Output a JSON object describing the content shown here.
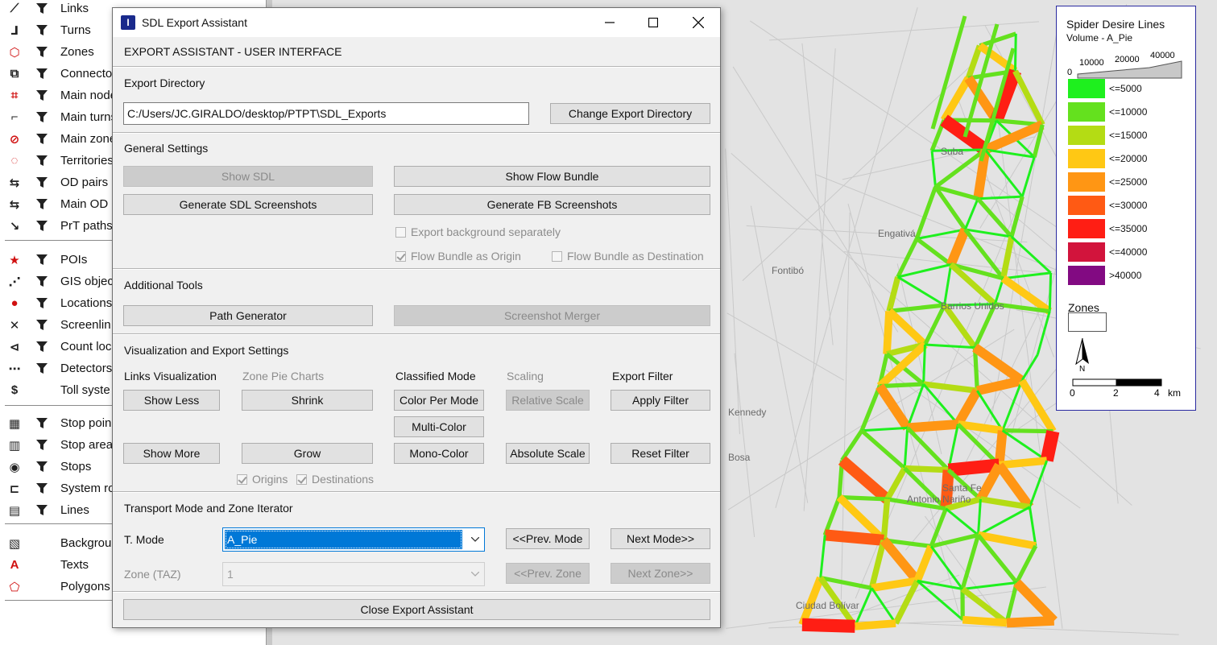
{
  "left_panel": {
    "items": [
      {
        "label": "Links",
        "icon": "links-icon",
        "filter": true
      },
      {
        "label": "Turns",
        "icon": "turns-icon",
        "filter": true
      },
      {
        "label": "Zones",
        "icon": "zones-icon",
        "filter": true
      },
      {
        "label": "Connecto",
        "icon": "connectors-icon",
        "filter": true
      },
      {
        "label": "Main node",
        "icon": "main-nodes-icon",
        "filter": true
      },
      {
        "label": "Main turns",
        "icon": "main-turns-icon",
        "filter": true
      },
      {
        "label": "Main zone",
        "icon": "main-zones-icon",
        "filter": true
      },
      {
        "label": "Territories",
        "icon": "territories-icon",
        "filter": true
      },
      {
        "label": "OD pairs",
        "icon": "od-pairs-icon",
        "filter": true
      },
      {
        "label": "Main OD p",
        "icon": "main-od-pairs-icon",
        "filter": true
      },
      {
        "label": "PrT paths",
        "icon": "prt-paths-icon",
        "filter": true
      },
      {
        "label": "POIs",
        "icon": "pois-icon",
        "filter": true
      },
      {
        "label": "GIS objec",
        "icon": "gis-objects-icon",
        "filter": true
      },
      {
        "label": "Locations",
        "icon": "locations-icon",
        "filter": true
      },
      {
        "label": "Screenlin",
        "icon": "screenlines-icon",
        "filter": true
      },
      {
        "label": "Count loc",
        "icon": "count-locations-icon",
        "filter": true
      },
      {
        "label": "Detectors",
        "icon": "detectors-icon",
        "filter": true
      },
      {
        "label": "Toll syste",
        "icon": "toll-systems-icon",
        "filter": false
      },
      {
        "label": "Stop poin",
        "icon": "stop-points-icon",
        "filter": true
      },
      {
        "label": "Stop area",
        "icon": "stop-areas-icon",
        "filter": true
      },
      {
        "label": "Stops",
        "icon": "stops-icon",
        "filter": true
      },
      {
        "label": "System ro",
        "icon": "system-routes-icon",
        "filter": true
      },
      {
        "label": "Lines",
        "icon": "lines-icon",
        "filter": true
      },
      {
        "label": "Backgrou",
        "icon": "backgrounds-icon",
        "filter": false
      },
      {
        "label": "Texts",
        "icon": "texts-icon",
        "filter": false
      },
      {
        "label": "Polygons",
        "icon": "polygons-icon",
        "filter": false
      }
    ]
  },
  "dialog": {
    "title": "SDL Export Assistant",
    "header": "EXPORT ASSISTANT - USER INTERFACE",
    "export_directory": {
      "heading": "Export Directory",
      "path": "C:/Users/JC.GIRALDO/desktop/PTPT\\SDL_Exports",
      "change_button": "Change Export Directory"
    },
    "general": {
      "heading": "General Settings",
      "show_sdl": "Show SDL",
      "show_flow_bundle": "Show Flow Bundle",
      "gen_sdl_screens": "Generate SDL Screenshots",
      "gen_fb_screens": "Generate FB Screenshots",
      "export_bg": "Export background separately",
      "fb_origin": "Flow Bundle as Origin",
      "fb_destination": "Flow Bundle as Destination"
    },
    "tools": {
      "heading": "Additional Tools",
      "path_generator": "Path Generator",
      "screenshot_merger": "Screenshot Merger"
    },
    "viz": {
      "heading": "Visualization and Export Settings",
      "links_vis": "Links Visualization",
      "zone_pie": "Zone Pie Charts",
      "classified": "Classified Mode",
      "scaling": "Scaling",
      "export_filter": "Export Filter",
      "show_less": "Show Less",
      "shrink": "Shrink",
      "color_per_mode": "Color Per Mode",
      "relative_scale": "Relative Scale",
      "apply_filter": "Apply Filter",
      "multi_color": "Multi-Color",
      "show_more": "Show More",
      "grow": "Grow",
      "mono_color": "Mono-Color",
      "absolute_scale": "Absolute Scale",
      "reset_filter": "Reset Filter",
      "origins": "Origins",
      "destinations": "Destinations"
    },
    "iterator": {
      "heading": "Transport Mode and Zone Iterator",
      "t_mode_label": "T. Mode",
      "t_mode_value": "A_Pie",
      "prev_mode": "<<Prev. Mode",
      "next_mode": "Next Mode>>",
      "zone_label": "Zone (TAZ)",
      "zone_value": "1",
      "prev_zone": "<<Prev. Zone",
      "next_zone": "Next Zone>>"
    },
    "close_button": "Close Export Assistant"
  },
  "legend": {
    "title": "Spider Desire Lines",
    "subtitle": "Volume - A_Pie",
    "scale_labels": [
      "0",
      "10000",
      "20000",
      "40000"
    ],
    "classes": [
      {
        "label": "<=5000",
        "color": "#1ef01e"
      },
      {
        "label": "<=10000",
        "color": "#64e11e"
      },
      {
        "label": "<=15000",
        "color": "#b4dc14"
      },
      {
        "label": "<=20000",
        "color": "#ffc814"
      },
      {
        "label": "<=25000",
        "color": "#ff9614"
      },
      {
        "label": "<=30000",
        "color": "#ff5a14"
      },
      {
        "label": "<=35000",
        "color": "#ff1e14"
      },
      {
        "label": "<=40000",
        "color": "#d2143c"
      },
      {
        "label": ">40000",
        "color": "#820a82"
      }
    ],
    "zones_label": "Zones",
    "north": "N",
    "km_labels": [
      "0",
      "2",
      "4",
      "km"
    ]
  },
  "map": {
    "place_labels": [
      "Suba",
      "Engativá",
      "Fontibó",
      "Barrios Unidos",
      "Kennedy",
      "Bosa",
      "Antonio Nariño",
      "Santa Fe",
      "Ciudad Bolívar"
    ]
  }
}
